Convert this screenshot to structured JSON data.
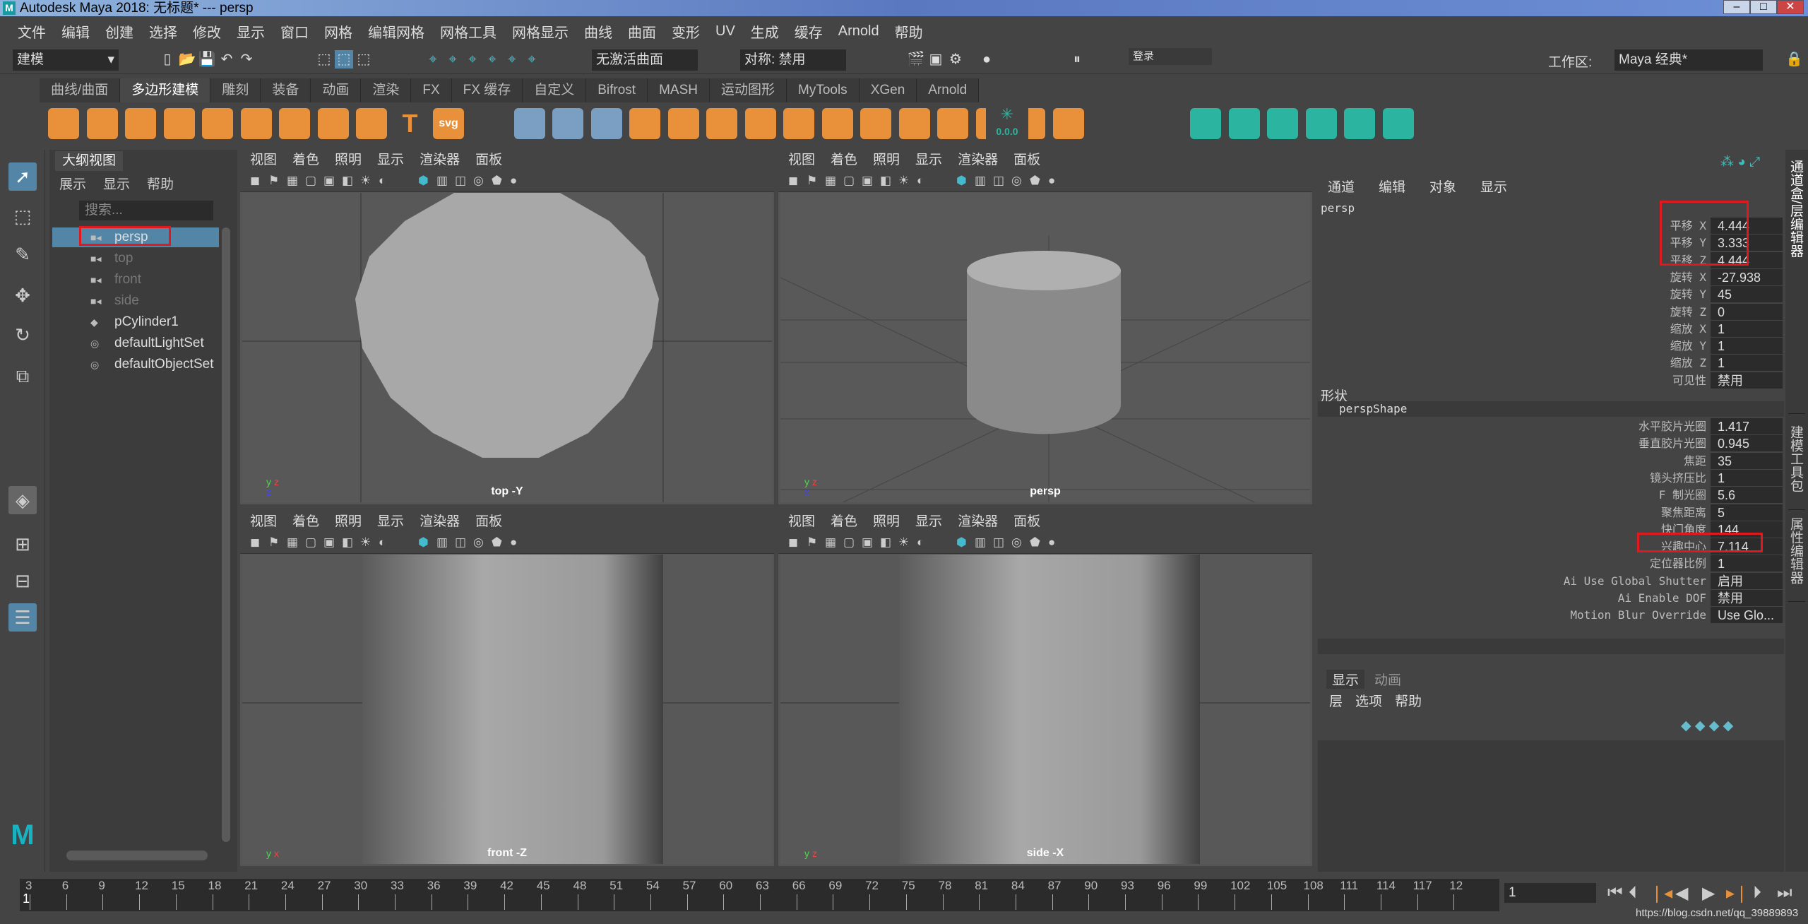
{
  "title": "Autodesk Maya 2018: 无标题*   ---   persp",
  "window_buttons": [
    "–",
    "□",
    "✕"
  ],
  "menu": [
    "文件",
    "编辑",
    "创建",
    "选择",
    "修改",
    "显示",
    "窗口",
    "网格",
    "编辑网格",
    "网格工具",
    "网格显示",
    "曲线",
    "曲面",
    "变形",
    "UV",
    "生成",
    "缓存",
    "Arnold",
    "帮助"
  ],
  "status": {
    "mode": "建模",
    "live_surface": "无激活曲面",
    "symmetry": "对称: 禁用",
    "login": "登录",
    "workspace_label": "工作区:",
    "workspace": "Maya 经典*"
  },
  "shelf_tabs": [
    "曲线/曲面",
    "多边形建模",
    "雕刻",
    "装备",
    "动画",
    "渲染",
    "FX",
    "FX 缓存",
    "自定义",
    "Bifrost",
    "MASH",
    "运动图形",
    "MyTools",
    "XGen",
    "Arnold"
  ],
  "shelf_active": 1,
  "shelf_icons": [
    "sphere",
    "cube",
    "cylinder",
    "cone",
    "torus",
    "plane",
    "disc",
    "platonic",
    "super-shape",
    "type",
    "svg",
    "mirror",
    "combine",
    "separate",
    "smooth",
    "extrude",
    "bridge",
    "bevel",
    "fill-hole",
    "append",
    "multi-cut",
    "target-weld",
    "quad-draw",
    "uv-editor",
    "planar",
    "automatic",
    "cut-uv",
    "sew-uv",
    "unfold",
    "checker",
    "layout",
    "transfer"
  ],
  "shelf_text": {
    "type": "T",
    "svg": "svg",
    "counter": "0.0.0"
  },
  "outliner": {
    "title": "大纲视图",
    "menu": [
      "展示",
      "显示",
      "帮助"
    ],
    "search_placeholder": "搜索...",
    "items": [
      {
        "label": "persp",
        "type": "camera",
        "selected": true,
        "dim": false
      },
      {
        "label": "top",
        "type": "camera",
        "selected": false,
        "dim": true
      },
      {
        "label": "front",
        "type": "camera",
        "selected": false,
        "dim": true
      },
      {
        "label": "side",
        "type": "camera",
        "selected": false,
        "dim": true
      },
      {
        "label": "pCylinder1",
        "type": "mesh",
        "selected": false,
        "dim": false
      },
      {
        "label": "defaultLightSet",
        "type": "set",
        "selected": false,
        "dim": false
      },
      {
        "label": "defaultObjectSet",
        "type": "set",
        "selected": false,
        "dim": false
      }
    ]
  },
  "viewport_menu": [
    "视图",
    "着色",
    "照明",
    "显示",
    "渲染器",
    "面板"
  ],
  "viewports": [
    {
      "label": "top -Y",
      "axes": [
        "y",
        "z",
        "z"
      ]
    },
    {
      "label": "persp",
      "axes": [
        "y",
        "z",
        "x"
      ]
    },
    {
      "label": "front -Z",
      "axes": [
        "y",
        "x",
        ""
      ]
    },
    {
      "label": "side -X",
      "axes": [
        "y",
        "z",
        ""
      ]
    }
  ],
  "channel_box": {
    "menu": [
      "通道",
      "编辑",
      "对象",
      "显示"
    ],
    "node": "persp",
    "transform": [
      [
        "平移 X",
        "4.444"
      ],
      [
        "平移 Y",
        "3.333"
      ],
      [
        "平移 Z",
        "4.444"
      ],
      [
        "旋转 X",
        "-27.938"
      ],
      [
        "旋转 Y",
        "45"
      ],
      [
        "旋转 Z",
        "0"
      ],
      [
        "缩放 X",
        "1"
      ],
      [
        "缩放 Y",
        "1"
      ],
      [
        "缩放 Z",
        "1"
      ],
      [
        "可见性",
        "禁用"
      ]
    ],
    "shapes_label": "形状",
    "shape_node": "perspShape",
    "shape": [
      [
        "水平胶片光圈",
        "1.417"
      ],
      [
        "垂直胶片光圈",
        "0.945"
      ],
      [
        "焦距",
        "35"
      ],
      [
        "镜头挤压比",
        "1"
      ],
      [
        "F 制光圈",
        "5.6"
      ],
      [
        "聚焦距离",
        "5"
      ],
      [
        "快门角度",
        "144"
      ],
      [
        "兴趣中心",
        "7.114"
      ],
      [
        "定位器比例",
        "1"
      ],
      [
        "Ai Use Global Shutter",
        "启用"
      ],
      [
        "Ai Enable DOF",
        "禁用"
      ],
      [
        "Motion Blur Override",
        "Use Glo..."
      ]
    ]
  },
  "side_tabs": [
    "通道盒/层编辑器",
    "建模工具包",
    "属性编辑器"
  ],
  "layer_editor": {
    "tabs": [
      "显示",
      "动画"
    ],
    "menu": [
      "层",
      "选项",
      "帮助"
    ]
  },
  "timeline": {
    "ticks": [
      "3",
      "6",
      "9",
      "12",
      "15",
      "18",
      "21",
      "24",
      "27",
      "30",
      "33",
      "36",
      "39",
      "42",
      "45",
      "48",
      "51",
      "54",
      "57",
      "60",
      "63",
      "66",
      "69",
      "72",
      "75",
      "78",
      "81",
      "84",
      "87",
      "90",
      "93",
      "96",
      "99",
      "102",
      "105",
      "108",
      "111",
      "114",
      "117",
      "12"
    ],
    "current_frame": "1",
    "frame_field": "1",
    "watermark": "https://blog.csdn.net/qq_39889893"
  },
  "colors": {
    "accent": "#5285a6",
    "highlight": "#e0191f",
    "shelf_orange": "#e8913a",
    "shelf_teal": "#2bb5a0"
  }
}
